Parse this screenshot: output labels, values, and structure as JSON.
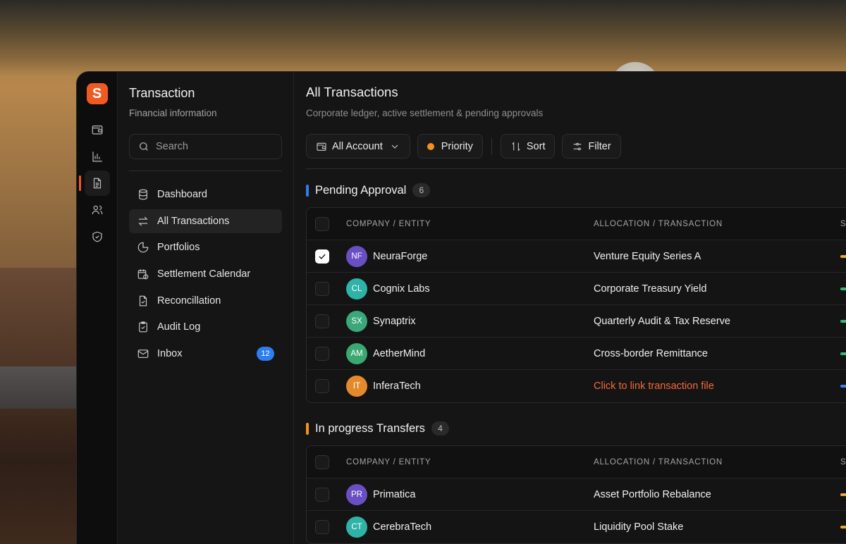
{
  "app": {
    "logo_letter": "S"
  },
  "rail": [
    {
      "icon": "wallet-icon"
    },
    {
      "icon": "chart-icon"
    },
    {
      "icon": "document-icon",
      "active": true
    },
    {
      "icon": "users-icon"
    },
    {
      "icon": "shield-check-icon"
    }
  ],
  "sidebar": {
    "title": "Transaction",
    "subtitle": "Financial information",
    "search_placeholder": "Search",
    "items": [
      {
        "label": "Dashboard",
        "icon": "database-icon"
      },
      {
        "label": "All Transactions",
        "icon": "swap-arrows-icon",
        "active": true
      },
      {
        "label": "Portfolios",
        "icon": "pie-chart-icon"
      },
      {
        "label": "Settlement Calendar",
        "icon": "calendar-clock-icon"
      },
      {
        "label": "Reconcillation",
        "icon": "file-check-icon"
      },
      {
        "label": "Audit Log",
        "icon": "clipboard-check-icon"
      },
      {
        "label": "Inbox",
        "icon": "mail-icon",
        "badge": "12"
      }
    ]
  },
  "main": {
    "title": "All Transactions",
    "subtitle": "Corporate ledger, active settlement & pending approvals",
    "toolbar": {
      "account_label": "All Account",
      "priority_label": "Priority",
      "sort_label": "Sort",
      "filter_label": "Filter"
    },
    "columns": {
      "company": "COMPANY / ENTITY",
      "allocation": "ALLOCATION / TRANSACTION",
      "status_initial": "S"
    }
  },
  "sections": [
    {
      "title": "Pending Approval",
      "count": "6",
      "accent": "#2d7ff0",
      "rows": [
        {
          "initials": "NF",
          "company": "NeuraForge",
          "allocation": "Venture Equity Series A",
          "avatar_color": "#6a4fc4",
          "status_color": "#f5a623",
          "checked": true
        },
        {
          "initials": "CL",
          "company": "Cognix Labs",
          "allocation": "Corporate Treasury Yield",
          "avatar_color": "#2fb3a6",
          "status_color": "#2ebd6b"
        },
        {
          "initials": "SX",
          "company": "Synaptrix",
          "allocation": "Quarterly Audit & Tax Reserve",
          "avatar_color": "#3aa87a",
          "status_color": "#2ebd6b"
        },
        {
          "initials": "AM",
          "company": "AetherMind",
          "allocation": "Cross-border Remittance",
          "avatar_color": "#3aa870",
          "status_color": "#2ebd6b"
        },
        {
          "initials": "IT",
          "company": "InferaTech",
          "allocation": "Click to link transaction file",
          "avatar_color": "#e58a2c",
          "status_color": "#3b82f6",
          "is_link": true
        }
      ]
    },
    {
      "title": "In progress Transfers",
      "count": "4",
      "accent": "#f5921e",
      "rows": [
        {
          "initials": "PR",
          "company": "Primatica",
          "allocation": "Asset Portfolio Rebalance",
          "avatar_color": "#6a4fc4",
          "status_color": "#f5a623"
        },
        {
          "initials": "CT",
          "company": "CerebraTech",
          "allocation": "Liquidity Pool Stake",
          "avatar_color": "#2fb3a6",
          "status_color": "#f5a623"
        }
      ]
    }
  ]
}
